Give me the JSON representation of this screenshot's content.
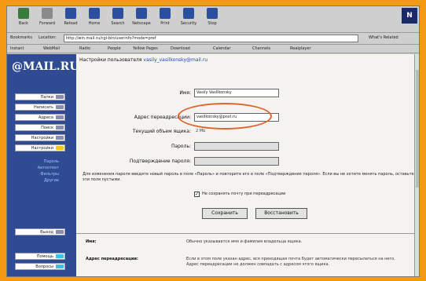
{
  "toolbar": {
    "buttons": [
      {
        "label": "Back",
        "icon": "back-arrow-icon",
        "color": "#3a7a3a"
      },
      {
        "label": "Forward",
        "icon": "forward-arrow-icon",
        "color": "#8a8a8a"
      },
      {
        "label": "Reload",
        "icon": "reload-icon",
        "color": "#2a4ea0"
      },
      {
        "label": "Home",
        "icon": "home-icon",
        "color": "#2a4ea0"
      },
      {
        "label": "Search",
        "icon": "search-icon",
        "color": "#2a4ea0"
      },
      {
        "label": "Netscape",
        "icon": "netscape-icon",
        "color": "#2a4ea0"
      },
      {
        "label": "Print",
        "icon": "print-icon",
        "color": "#2a4ea0"
      },
      {
        "label": "Security",
        "icon": "security-icon",
        "color": "#2a4ea0"
      },
      {
        "label": "Stop",
        "icon": "stop-icon",
        "color": "#2a4ea0"
      }
    ],
    "brand": "N"
  },
  "location": {
    "bookmarks_label": "Bookmarks",
    "location_label": "Location:",
    "url": "http://win.mail.ru/cgi-bin/userinfo?mode=pref",
    "related_label": "What's Related"
  },
  "links": [
    "Instant",
    "WebMail",
    "Radio",
    "People",
    "Yellow Pages",
    "Download",
    "Calendar",
    "Channels",
    "Realplayer"
  ],
  "sidebar": {
    "brand": "@MAIL.RU",
    "buttons": [
      "Папки",
      "Написать",
      "Адреса",
      "Поиск",
      "Настройки",
      "Настройки"
    ],
    "sublinks": [
      "Пароль",
      "Автоответ",
      "Фильтры",
      "Другие"
    ],
    "bottom_buttons": [
      "Выход",
      "Помощь",
      "Вопросы"
    ]
  },
  "content": {
    "title_prefix": "Настройки пользователя",
    "title_email": "vasily_vasilkonsky@mail.ru",
    "fields": [
      {
        "label": "Имя:",
        "value": "Vasily Vasilkonsky",
        "gray": false
      },
      {
        "label": "Адрес переадресации:",
        "value": "vasilkonsky@post.ru",
        "gray": false
      },
      {
        "label": "Текущий объем ящика:",
        "value": "2 Mb",
        "static": true
      },
      {
        "label": "Пароль:",
        "value": "",
        "gray": true
      },
      {
        "label": "Подтверждение пароля:",
        "value": "",
        "gray": true
      }
    ],
    "note": "Для изменения пароля введите новый пароль в поле «Пароль» и повторите его в поле «Подтверждение пароля». Если вы не хотите менять пароль, оставьте эти поля пустыми.",
    "checkbox_label": "Не сохранять почту при переадресации",
    "buttons": [
      "Сохранить",
      "Восстановить"
    ],
    "help": [
      {
        "term": "Имя:",
        "desc": "Обычно указывается имя и фамилия владельца ящика."
      },
      {
        "term": "Адрес переадресации:",
        "desc": "Если в этом поле указан адрес, вся приходящая почта будет автоматически пересылаться на него. Адрес переадресации не должен совпадать с адресом этого ящика."
      }
    ]
  }
}
